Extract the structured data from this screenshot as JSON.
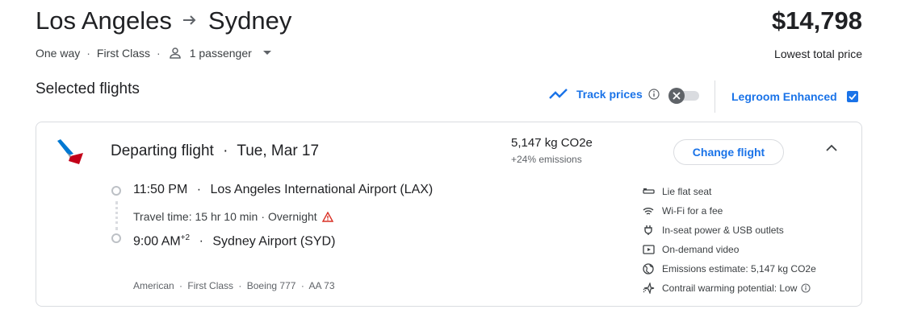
{
  "trip": {
    "origin": "Los Angeles",
    "destination": "Sydney",
    "trip_type": "One way",
    "cabin_class": "First Class",
    "passengers": "1 passenger"
  },
  "price": {
    "amount": "$14,798",
    "label": "Lowest total price"
  },
  "section_title": "Selected flights",
  "track_prices": {
    "label": "Track prices",
    "enabled": false
  },
  "legroom": {
    "label": "Legroom Enhanced",
    "checked": true
  },
  "flight": {
    "title": "Departing flight",
    "date": "Tue, Mar 17",
    "emissions": "5,147 kg CO2e",
    "emissions_delta": "+24% emissions",
    "change_button": "Change flight",
    "departure_time": "11:50 PM",
    "departure_airport": "Los Angeles International Airport (LAX)",
    "travel_time": "Travel time: 15 hr 10 min",
    "overnight": "Overnight",
    "arrival_time": "9:00 AM",
    "arrival_day_offset": "+2",
    "arrival_airport": "Sydney Airport (SYD)",
    "airline": "American",
    "cabin": "First Class",
    "aircraft": "Boeing 777",
    "flight_number": "AA 73"
  },
  "amenities": [
    {
      "icon": "lie-flat-seat-icon",
      "label": "Lie flat seat"
    },
    {
      "icon": "wifi-icon",
      "label": "Wi-Fi for a fee"
    },
    {
      "icon": "power-plug-icon",
      "label": "In-seat power & USB outlets"
    },
    {
      "icon": "video-icon",
      "label": "On-demand video"
    },
    {
      "icon": "globe-icon",
      "label": "Emissions estimate: 5,147 kg CO2e"
    },
    {
      "icon": "contrail-icon",
      "label": "Contrail warming potential: Low"
    }
  ],
  "colors": {
    "accent": "#1a73e8",
    "warning": "#d93025",
    "airline_blue": "#0078d2",
    "airline_red": "#c30019"
  },
  "separators": {
    "dot": "·"
  }
}
